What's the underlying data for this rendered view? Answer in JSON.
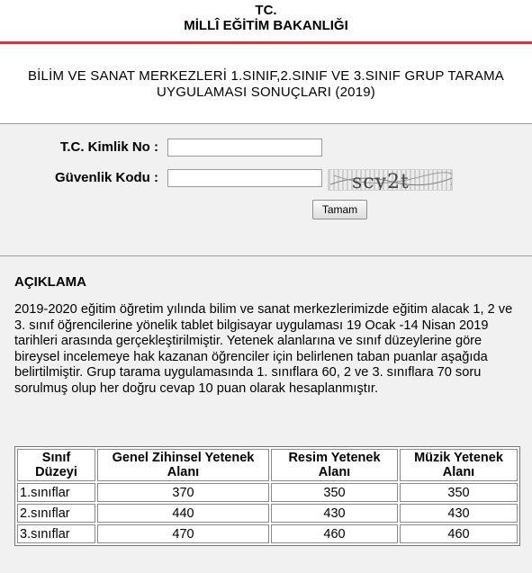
{
  "header": {
    "line1": "TC.",
    "line2": "MİLLÎ EĞİTİM BAKANLIĞI"
  },
  "subtitle": {
    "line1": "BİLİM VE SANAT MERKEZLERİ 1.SINIF,2.SINIF VE 3.SINIF GRUP TARAMA",
    "line2": "UYGULAMASI SONUÇLARI (2019)"
  },
  "form": {
    "tc_label": "T.C. Kimlik No :",
    "tc_value": "",
    "captcha_label": "Güvenlik Kodu :",
    "captcha_value": "",
    "captcha_text": "scy2t",
    "submit_label": "Tamam"
  },
  "description": {
    "heading": "AÇIKLAMA",
    "body": "2019-2020 eğitim öğretim yılında bilim ve sanat merkezlerimizde eğitim alacak 1, 2 ve 3. sınıf öğrencilerine yönelik tablet bilgisayar uygulaması 19 Ocak -14 Nisan 2019 tarihleri arasında gerçekleştirilmiştir. Yetenek alanlarına ve sınıf düzeylerine göre bireysel incelemeye hak kazanan öğrenciler için belirlenen taban puanlar aşağıda belirtilmiştir. Grup tarama uygulamasında 1. sınıflara 60, 2 ve 3. sınıflara 70 soru sorulmuş olup her doğru cevap 10 puan olarak hesaplanmıştır."
  },
  "table": {
    "headers": [
      [
        "Sınıf",
        "Düzeyi"
      ],
      [
        "Genel Zihinsel Yetenek",
        "Alanı"
      ],
      [
        "Resim Yetenek",
        "Alanı"
      ],
      [
        "Müzik Yetenek",
        "Alanı"
      ]
    ],
    "rows": [
      [
        "1.sınıflar",
        "370",
        "350",
        "350"
      ],
      [
        "2.sınıflar",
        "440",
        "430",
        "430"
      ],
      [
        "3.sınıflar",
        "470",
        "460",
        "460"
      ]
    ]
  },
  "colors": {
    "accent_rule": "#d6343a",
    "page_bg": "#f1f1f1"
  }
}
